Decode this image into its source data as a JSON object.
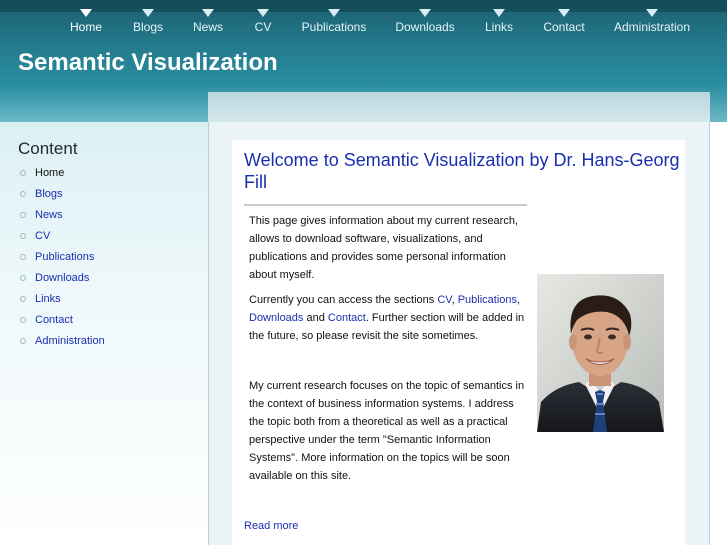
{
  "nav": {
    "items": [
      {
        "label": "Home"
      },
      {
        "label": "Blogs"
      },
      {
        "label": "News"
      },
      {
        "label": "CV"
      },
      {
        "label": "Publications"
      },
      {
        "label": "Downloads"
      },
      {
        "label": "Links"
      },
      {
        "label": "Contact"
      },
      {
        "label": "Administration"
      }
    ]
  },
  "site": {
    "title": "Semantic Visualization"
  },
  "sidebar": {
    "title": "Content",
    "items": [
      {
        "label": "Home"
      },
      {
        "label": "Blogs"
      },
      {
        "label": "News"
      },
      {
        "label": "CV"
      },
      {
        "label": "Publications"
      },
      {
        "label": "Downloads"
      },
      {
        "label": "Links"
      },
      {
        "label": "Contact"
      },
      {
        "label": "Administration"
      }
    ]
  },
  "article": {
    "title": "Welcome to Semantic Visualization by Dr. Hans-Georg Fill",
    "p1": "This page gives information about my current research, allows to download software, visualizations, and publications and provides some personal information about myself.",
    "p2": {
      "t1": "Currently you can access the sections ",
      "link_cv": "CV",
      "t2": ", ",
      "link_publications": "Publications",
      "t3": ", ",
      "link_downloads": "Downloads",
      "t4": " and ",
      "link_contact": "Contact",
      "t5": ". Further section will be added in the future, so please revisit the site sometimes."
    },
    "p3": "My current research focuses on the topic of semantics in the context of business information systems. I address the topic both from a theoretical as well as a practical perspective under the term \"Semantic Information Systems\". More information on the topics will be soon available on this site.",
    "read_more": "Read more"
  },
  "colors": {
    "header": "#247c8e",
    "link": "#1a2fb0",
    "sidebar_bg": "#dcf0f4"
  }
}
